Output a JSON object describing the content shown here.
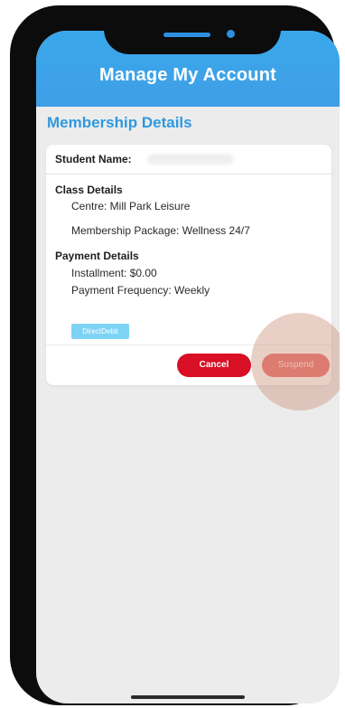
{
  "header": {
    "title": "Manage My Account"
  },
  "section": {
    "title": "Membership Details"
  },
  "student": {
    "label": "Student Name:"
  },
  "class_details": {
    "title": "Class Details",
    "centre": "Centre: Mill Park Leisure",
    "package": "Membership Package: Wellness 24/7"
  },
  "payment_details": {
    "title": "Payment Details",
    "installment": "Installment: $0.00",
    "frequency": "Payment Frequency: Weekly",
    "method_badge": "DirectDebit"
  },
  "actions": {
    "cancel": "Cancel",
    "suspend": "Suspend"
  },
  "colors": {
    "header": "#3aa7ea",
    "section_title": "#2f98df",
    "cancel": "#d80f25",
    "suspend": "#e86763",
    "badge": "#7ed3f5"
  }
}
